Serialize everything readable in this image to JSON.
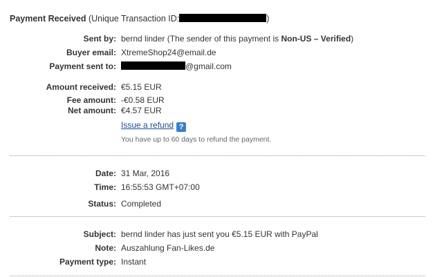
{
  "header": {
    "title_bold": "Payment Received",
    "title_rest_prefix": "(Unique Transaction ID:",
    "title_rest_suffix": ")"
  },
  "sender": {
    "sent_by_label": "Sent by:",
    "sent_by_name": "bernd linder",
    "sent_by_note_prefix": "(The sender of this payment is ",
    "sent_by_status": "Non-US – Verified",
    "sent_by_note_suffix": ")",
    "buyer_email_label": "Buyer email:",
    "buyer_email": "XtremeShop24@email.de",
    "payment_sent_to_label": "Payment sent to:",
    "payment_sent_to_domain": "@gmail.com"
  },
  "amounts": {
    "amount_received_label": "Amount received:",
    "amount_received": "€5.15 EUR",
    "fee_label": "Fee amount:",
    "fee": "-€0.58 EUR",
    "net_label": "Net amount:",
    "net": "€4.57 EUR",
    "refund_link": "Issue a refund",
    "help_icon": "?",
    "refund_note": "You have up to 60 days to refund the payment."
  },
  "details": {
    "date_label": "Date:",
    "date": "31 Mar, 2016",
    "time_label": "Time:",
    "time": "16:55:53 GMT+07:00",
    "status_label": "Status:",
    "status": "Completed"
  },
  "message": {
    "subject_label": "Subject:",
    "subject": "bernd linder has just sent you €5.15 EUR with PayPal",
    "note_label": "Note:",
    "note": "Auszahlung Fan-Likes.de",
    "payment_type_label": "Payment type:",
    "payment_type": "Instant"
  },
  "colors": {
    "link": "#1a4c94",
    "help_icon_bg": "#3c7fc9",
    "redaction": "#000000"
  }
}
